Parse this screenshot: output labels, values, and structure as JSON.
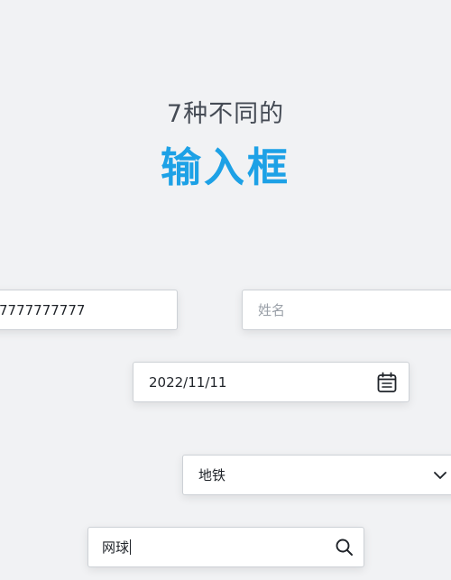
{
  "header": {
    "subtitle": "7种不同的",
    "title": "输入框"
  },
  "inputs": {
    "phone": {
      "value": "7777777777"
    },
    "name": {
      "placeholder": "姓名",
      "value": ""
    },
    "date": {
      "value": "2022/11/11",
      "icon": "calendar-icon"
    },
    "select": {
      "selected": "地铁",
      "icon": "chevron-down-icon"
    },
    "search": {
      "value": "网球",
      "icon": "search-icon"
    }
  },
  "colors": {
    "background": "#f1f2f4",
    "accent": "#1da1e6",
    "text": "#1f2329",
    "placeholder": "#9aa0a8"
  }
}
